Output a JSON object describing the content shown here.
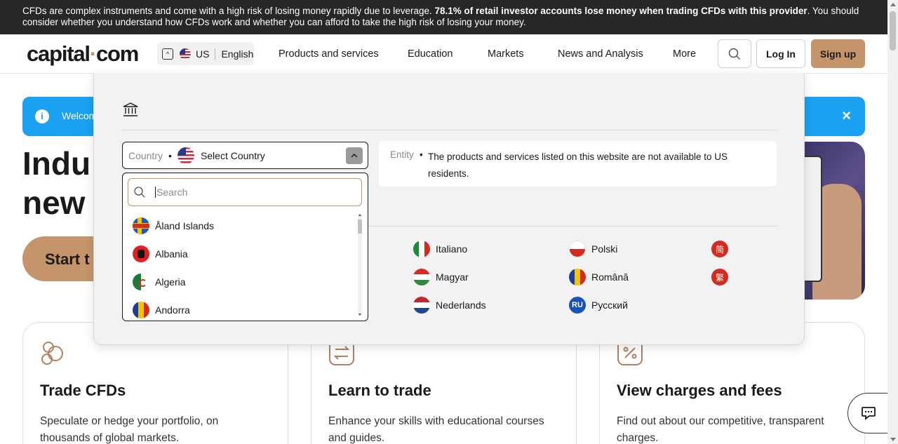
{
  "risk_banner": {
    "text_start": "CFDs are complex instruments and come with a high risk of losing money rapidly due to leverage. ",
    "text_bold": "78.1% of retail investor accounts lose money when trading CFDs with this provider",
    "text_end": ". You should consider whether you understand how CFDs work and whether you can afford to take the high risk of losing your money."
  },
  "header": {
    "logo_part1": "capital",
    "logo_dot": "·",
    "logo_part2": "com",
    "region_country": "US",
    "region_language": "English",
    "nav": [
      "Products and services",
      "Education",
      "Markets",
      "News and Analysis",
      "More"
    ],
    "login_label": "Log In",
    "signup_label": "Sign up"
  },
  "welcome_banner": {
    "text": "Welcom"
  },
  "hero": {
    "line1": "Indu",
    "line2": "new",
    "cta_label": "Start t"
  },
  "cards": [
    {
      "title": "Trade CFDs",
      "body": "Speculate or hedge your portfolio, on thousands of global markets."
    },
    {
      "title": "Learn to trade",
      "body": "Enhance your skills with educational courses and guides."
    },
    {
      "title": "View charges and fees",
      "body": "Find out about our competitive, transparent charges."
    }
  ],
  "region_panel": {
    "country_label": "Country",
    "country_value": "Select Country",
    "entity_label": "Entity",
    "entity_text": "The products and services listed on this website are not available to US residents.",
    "search_placeholder": "Search",
    "countries": [
      "Åland Islands",
      "Albania",
      "Algeria",
      "Andorra"
    ],
    "languages": {
      "italian": "Italiano",
      "hungarian": "Magyar",
      "dutch": "Nederlands",
      "polish": "Polski",
      "romanian": "Română",
      "russian": "Русский",
      "russian_badge": "RU",
      "chinese_simplified_badge": "简",
      "chinese_traditional_badge": "繁"
    }
  },
  "colors": {
    "accent": "#c5946a",
    "banner_bg": "#272727",
    "info_blue": "#1ba1f2"
  }
}
